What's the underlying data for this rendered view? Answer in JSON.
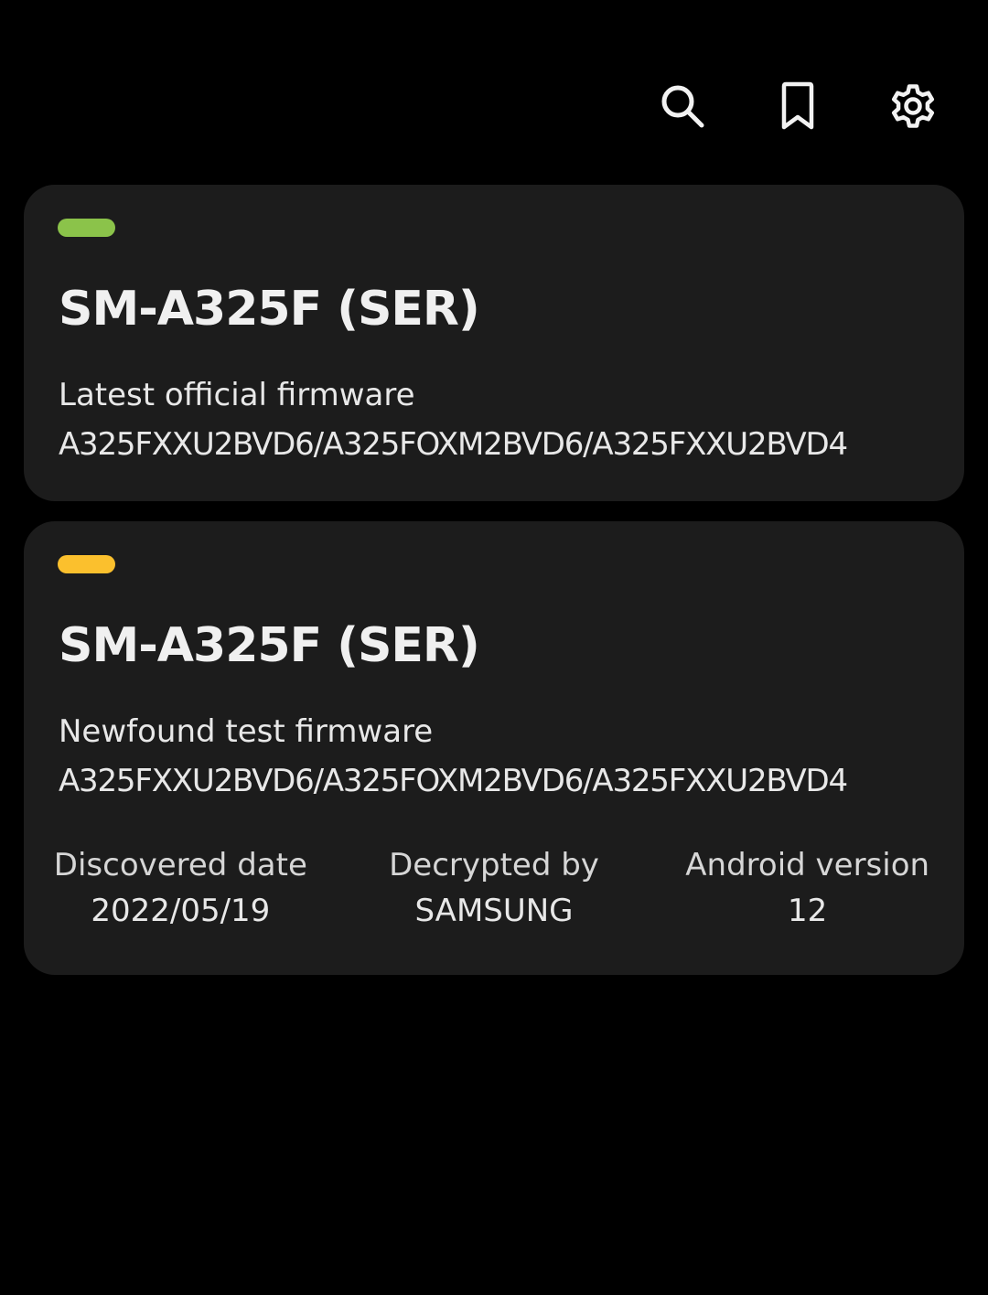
{
  "toolbar": {
    "icons": [
      "search-icon",
      "bookmark-icon",
      "gear-icon"
    ]
  },
  "cards": [
    {
      "status_color": "#8bc34a",
      "model": "SM-A325F (SER)",
      "type": "Latest official firmware",
      "version": "A325FXXU2BVD6/A325FOXM2BVD6/A325FXXU2BVD4"
    },
    {
      "status_color": "#fbc02d",
      "model": "SM-A325F (SER)",
      "type": "Newfound test firmware",
      "version": "A325FXXU2BVD6/A325FOXM2BVD6/A325FXXU2BVD4",
      "details": [
        {
          "label": "Discovered date",
          "value": "2022/05/19"
        },
        {
          "label": "Decrypted by",
          "value": "SAMSUNG"
        },
        {
          "label": "Android version",
          "value": "12"
        }
      ]
    }
  ]
}
